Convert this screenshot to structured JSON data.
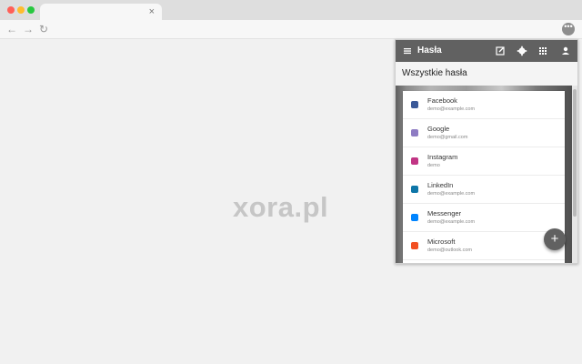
{
  "browser": {
    "traffic_lights": [
      "#ff5f57",
      "#febc2e",
      "#28c840"
    ],
    "tab_close": "×",
    "nav": {
      "back": "←",
      "forward": "→",
      "reload": "↻"
    },
    "extension_menu": "•••"
  },
  "watermark": "xora.pl",
  "popup": {
    "title": "Hasła",
    "subheader": "Wszystkie hasła",
    "toolbar_icons": [
      "menu-icon",
      "edit-icon",
      "gear-icon",
      "apps-icon",
      "account-icon"
    ],
    "accent": "#616161",
    "items": [
      {
        "name": "Facebook",
        "email": "demo@example.com",
        "icon": "facebook-icon",
        "color": "#3b5998"
      },
      {
        "name": "Google",
        "email": "demo@gmail.com",
        "icon": "google-icon",
        "color": "#8e7cc3"
      },
      {
        "name": "Instagram",
        "email": "demo",
        "icon": "instagram-icon",
        "color": "#c13584"
      },
      {
        "name": "LinkedIn",
        "email": "demo@example.com",
        "icon": "linkedin-icon",
        "color": "#0e76a8"
      },
      {
        "name": "Messenger",
        "email": "demo@example.com",
        "icon": "messenger-icon",
        "color": "#0084ff"
      },
      {
        "name": "Microsoft",
        "email": "demo@outlook.com",
        "icon": "microsoft-icon",
        "color": "#f25022"
      }
    ],
    "fab": "+"
  }
}
